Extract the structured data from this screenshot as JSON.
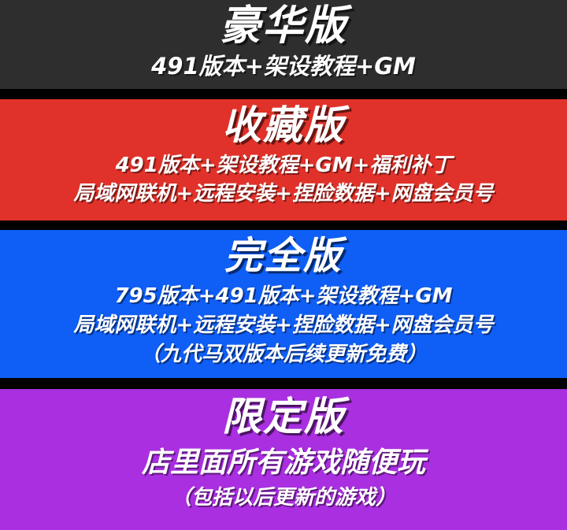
{
  "colors": {
    "deluxe_bg": "#2e2e2e",
    "collector_bg": "#e0322a",
    "complete_bg": "#0f5ef5",
    "limited_bg": "#a92fe0",
    "separator": "#000000",
    "text": "#ffffff"
  },
  "deluxe": {
    "title": "豪华版",
    "lines": [
      "491版本+架设教程+GM"
    ]
  },
  "collector": {
    "title": "收藏版",
    "lines": [
      "491版本+架设教程+GM+福利补丁",
      "局域网联机+远程安装+捏脸数据+网盘会员号"
    ]
  },
  "complete": {
    "title": "完全版",
    "lines": [
      "795版本+491版本+架设教程+GM",
      "局域网联机+远程安装+捏脸数据+网盘会员号",
      "（九代马双版本后续更新免费）"
    ]
  },
  "limited": {
    "title": "限定版",
    "lines": [
      "店里面所有游戏随便玩",
      "（包括以后更新的游戏）"
    ]
  }
}
